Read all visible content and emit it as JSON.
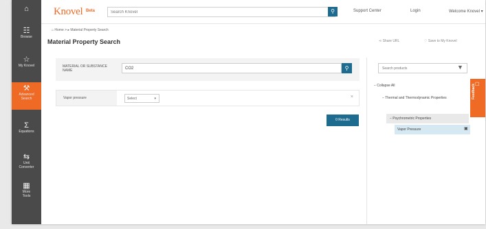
{
  "app": {
    "logo": "Knovel",
    "badge": "Beta"
  },
  "header": {
    "search_placeholder": "Search Knovel",
    "links": [
      "Support Center",
      "Login",
      "Welcome Knovel ▾"
    ]
  },
  "sidebar": {
    "items": [
      {
        "label": "",
        "icon": "home-icon",
        "glyph": "⌂",
        "active": false
      },
      {
        "label": "Browse",
        "icon": "browse-icon",
        "glyph": "☷",
        "active": false
      },
      {
        "label": "My Knovel",
        "icon": "star-icon",
        "glyph": "☆",
        "active": false
      },
      {
        "label": "Advanced Search",
        "icon": "advanced-search-icon",
        "glyph": "⚒",
        "active": true
      },
      {
        "label": "Equations",
        "icon": "sigma-icon",
        "glyph": "Σ",
        "active": false
      },
      {
        "label": "Unit Converter",
        "icon": "converter-icon",
        "glyph": "⇆",
        "active": false
      },
      {
        "label": "More Tools",
        "icon": "tools-icon",
        "glyph": "▦",
        "active": false
      }
    ]
  },
  "breadcrumb": "⌂ Home > ▸ Material Property Search",
  "page": {
    "title": "Material Property Search"
  },
  "actions": {
    "share": "Share URL",
    "save": "Save to My Knovel"
  },
  "material_field": {
    "label": "MATERIAL OR SUBSTANCE NAME",
    "value": "CO2"
  },
  "property_row": {
    "label": "Vapor pressure",
    "select": "Select"
  },
  "results_button": "0 Results",
  "right_panel": {
    "search_placeholder": "Search products",
    "tree": {
      "collapse_all": "− Collapse All",
      "group": "− Thermal and Thermodynamic Properties",
      "subgroup": "− Psychrometric Properties",
      "leaf": "Vapor Pressure"
    }
  },
  "feedback": "Feedback",
  "colors": {
    "accent": "#ee6a25",
    "primary": "#1e6b90",
    "sidebar": "#4a4a4a"
  }
}
